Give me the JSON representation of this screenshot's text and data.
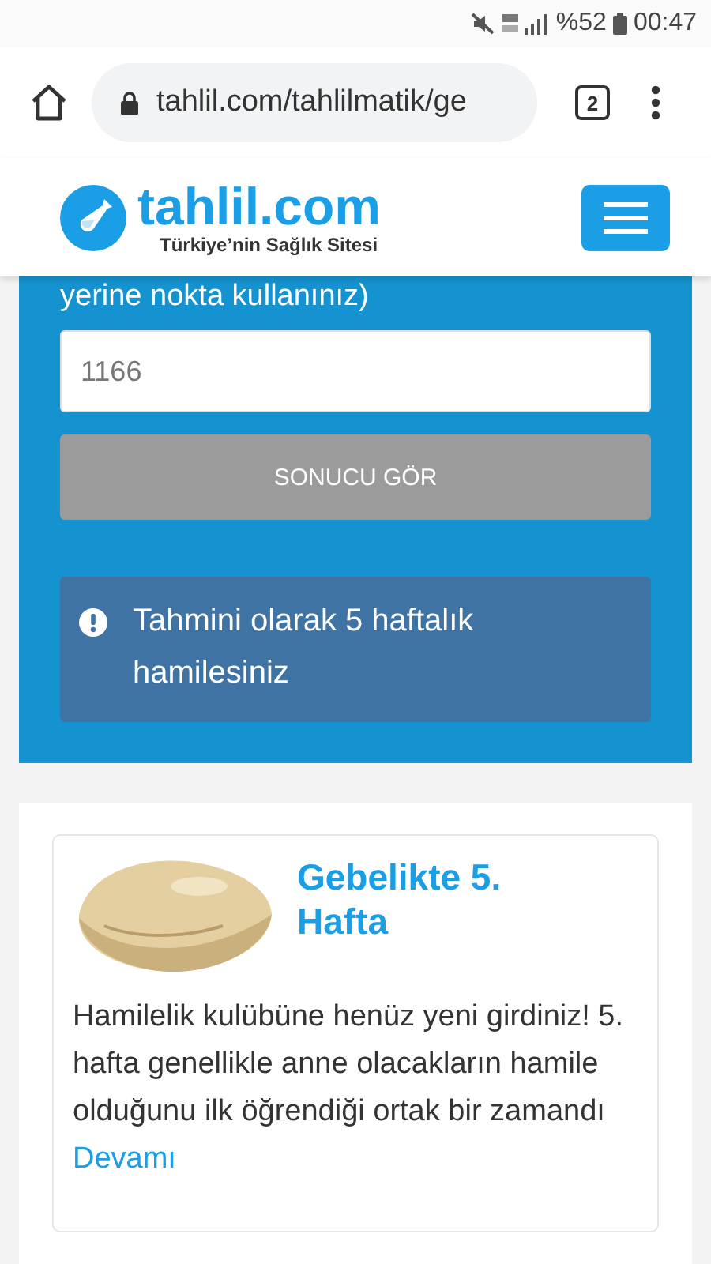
{
  "status_bar": {
    "battery": "%52",
    "time": "00:47"
  },
  "browser": {
    "url": "tahlil.com/tahlilmatik/ge",
    "tab_count": "2"
  },
  "site_header": {
    "logo_text": "tahlil.com",
    "tagline": "Türkiye’nin Sağlık Sitesi"
  },
  "calculator": {
    "note": "yerine nokta kullanınız)",
    "input": {
      "value": "1166"
    },
    "button": "SONUCU GÖR",
    "result": "Tahmini olarak 5 haftalık hamilesiniz"
  },
  "article": {
    "title": "Gebelikte 5. Hafta",
    "body": "Hamilelik kulübüne henüz yeni girdiniz! 5. hafta genellikle anne olacakların hamile olduğunu ilk  öğrendiği ortak bir zamandı",
    "link": "Devamı"
  }
}
